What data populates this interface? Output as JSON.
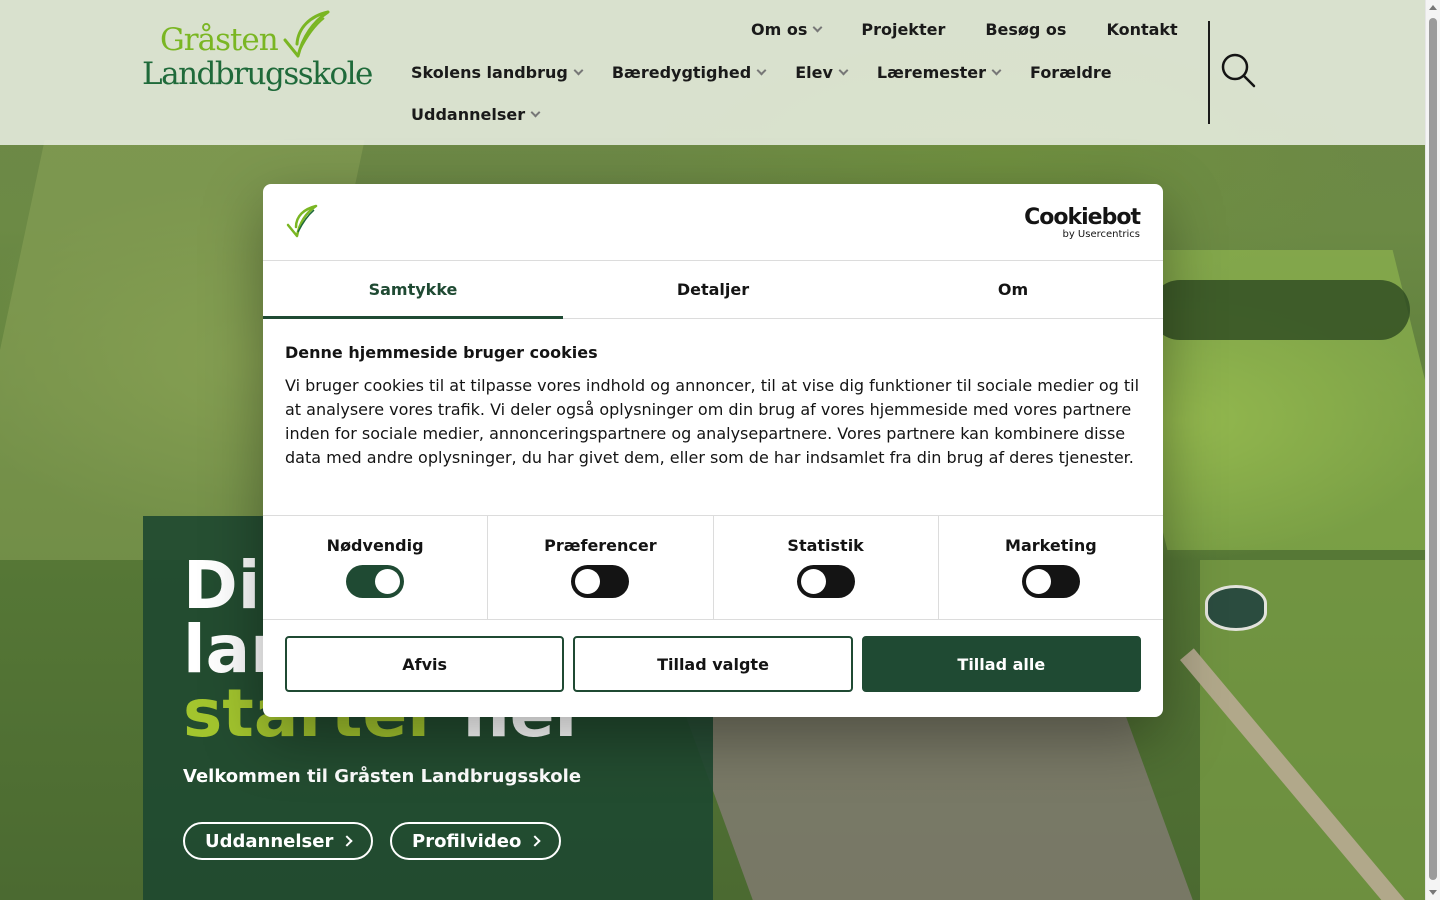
{
  "logo": {
    "line1": "Gråsten",
    "line2": "Landbrugsskole"
  },
  "top_nav": [
    {
      "label": "Om os",
      "dropdown": true
    },
    {
      "label": "Projekter",
      "dropdown": false
    },
    {
      "label": "Besøg os",
      "dropdown": false
    },
    {
      "label": "Kontakt",
      "dropdown": false
    }
  ],
  "main_nav": [
    {
      "label": "Skolens landbrug",
      "dropdown": true
    },
    {
      "label": "Bæredygtighed",
      "dropdown": true
    },
    {
      "label": "Elev",
      "dropdown": true
    },
    {
      "label": "Læremester",
      "dropdown": true
    },
    {
      "label": "Forældre",
      "dropdown": false
    },
    {
      "label": "Uddannelser",
      "dropdown": true
    }
  ],
  "search": {
    "icon": "search-icon"
  },
  "hero": {
    "line1": "Di",
    "line2": "lar",
    "line3_accent": "starter",
    "line3_rest": " her",
    "subtitle": "Velkommen til Gråsten Landbrugsskole",
    "buttons": [
      "Uddannelser",
      "Profilvideo"
    ]
  },
  "cookie_dialog": {
    "brand": "Cookiebot",
    "brand_sub": "by Usercentrics",
    "tabs": [
      "Samtykke",
      "Detaljer",
      "Om"
    ],
    "active_tab": "Samtykke",
    "title": "Denne hjemmeside bruger cookies",
    "text": "Vi bruger cookies til at tilpasse vores indhold og annoncer, til at vise dig funktioner til sociale medier og til at analysere vores trafik. Vi deler også oplysninger om din brug af vores hjemmeside med vores partnere inden for sociale medier, annonceringspartnere og analysepartnere. Vores partnere kan kombinere disse data med andre oplysninger, du har givet dem, eller som de har indsamlet fra din brug af deres tjenester.",
    "toggles": [
      {
        "label": "Nødvendig",
        "on": true
      },
      {
        "label": "Præferencer",
        "on": false
      },
      {
        "label": "Statistik",
        "on": false
      },
      {
        "label": "Marketing",
        "on": false
      }
    ],
    "buttons": {
      "reject": "Afvis",
      "allow_selected": "Tillad valgte",
      "allow_all": "Tillad alle"
    }
  },
  "colors": {
    "brand_dark": "#1f4a33",
    "brand_light": "#a3c52e",
    "logo_green": "#7ab623"
  }
}
